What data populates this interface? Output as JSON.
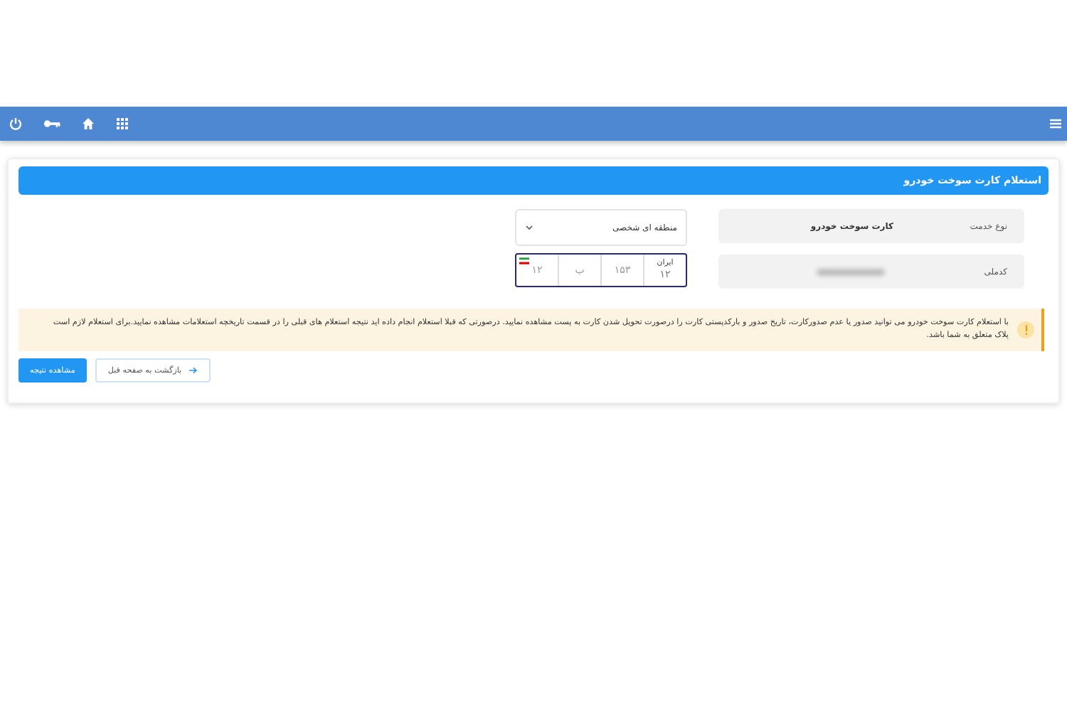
{
  "card": {
    "title": "استعلام کارت سوخت خودرو",
    "fields": [
      {
        "label": "نوع خدمت",
        "value": "کارت سوخت خودرو",
        "kind": "text"
      },
      {
        "label": "کدملی",
        "kind": "hidden"
      }
    ],
    "region_select": {
      "value": "منطقه ای شخصی"
    },
    "plate": {
      "country": "ایران",
      "code": "۱۲",
      "number": "۱۵۳",
      "letter": "ب",
      "prefix": "۱۲"
    },
    "alert": "با استعلام کارت سوخت خودرو می توانید صدور یا عدم صدورکارت، تاریخ صدور و بارکدپستی کارت را درصورت تحویل شدن کارت به پست مشاهده نمایید. درصورتی که قبلا استعلام انجام داده اید نتیجه استعلام های قبلی را در قسمت تاریخچه استعلامات مشاهده نمایید.برای استعلام لازم است پلاک متعلق به شما باشد.",
    "buttons": [
      {
        "label": "بازگشت به صفحه قبل",
        "kind": "back"
      },
      {
        "label": "مشاهده نتیجه",
        "kind": "primary"
      }
    ]
  }
}
